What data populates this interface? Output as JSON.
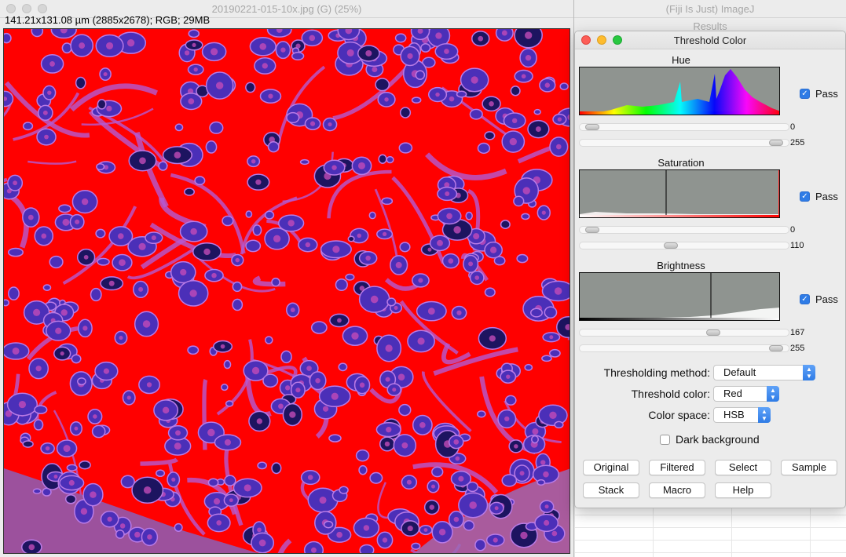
{
  "image_window": {
    "title": "20190221-015-10x.jpg (G) (25%)",
    "info": "141.21x131.08 µm (2885x2678); RGB; 29MB"
  },
  "background_windows": {
    "fiji_title": "(Fiji Is Just) ImageJ",
    "results_title": "Results"
  },
  "dialog": {
    "title": "Threshold Color",
    "hue": {
      "label": "Hue",
      "pass_label": "Pass",
      "pass_checked": true,
      "min": "0",
      "max": "255",
      "min_level": 0.03,
      "max_level": 0.97
    },
    "saturation": {
      "label": "Saturation",
      "pass_label": "Pass",
      "pass_checked": true,
      "min": "0",
      "max": "110",
      "min_level": 0.03,
      "max_level": 0.43
    },
    "brightness": {
      "label": "Brightness",
      "pass_label": "Pass",
      "pass_checked": true,
      "min": "167",
      "max": "255",
      "min_level": 0.65,
      "max_level": 0.97
    },
    "thresholding_method": {
      "label": "Thresholding method:",
      "value": "Default"
    },
    "threshold_color": {
      "label": "Threshold color:",
      "value": "Red"
    },
    "color_space": {
      "label": "Color space:",
      "value": "HSB"
    },
    "dark_background": {
      "label": "Dark background",
      "checked": false
    },
    "buttons": {
      "original": "Original",
      "filtered": "Filtered",
      "select": "Select",
      "sample": "Sample",
      "stack": "Stack",
      "macro": "Macro",
      "help": "Help"
    }
  },
  "colors": {
    "threshold_fill": "#ff0000",
    "cell_purple": "#4b2fb8",
    "accent_blue": "#2f7ce6"
  }
}
